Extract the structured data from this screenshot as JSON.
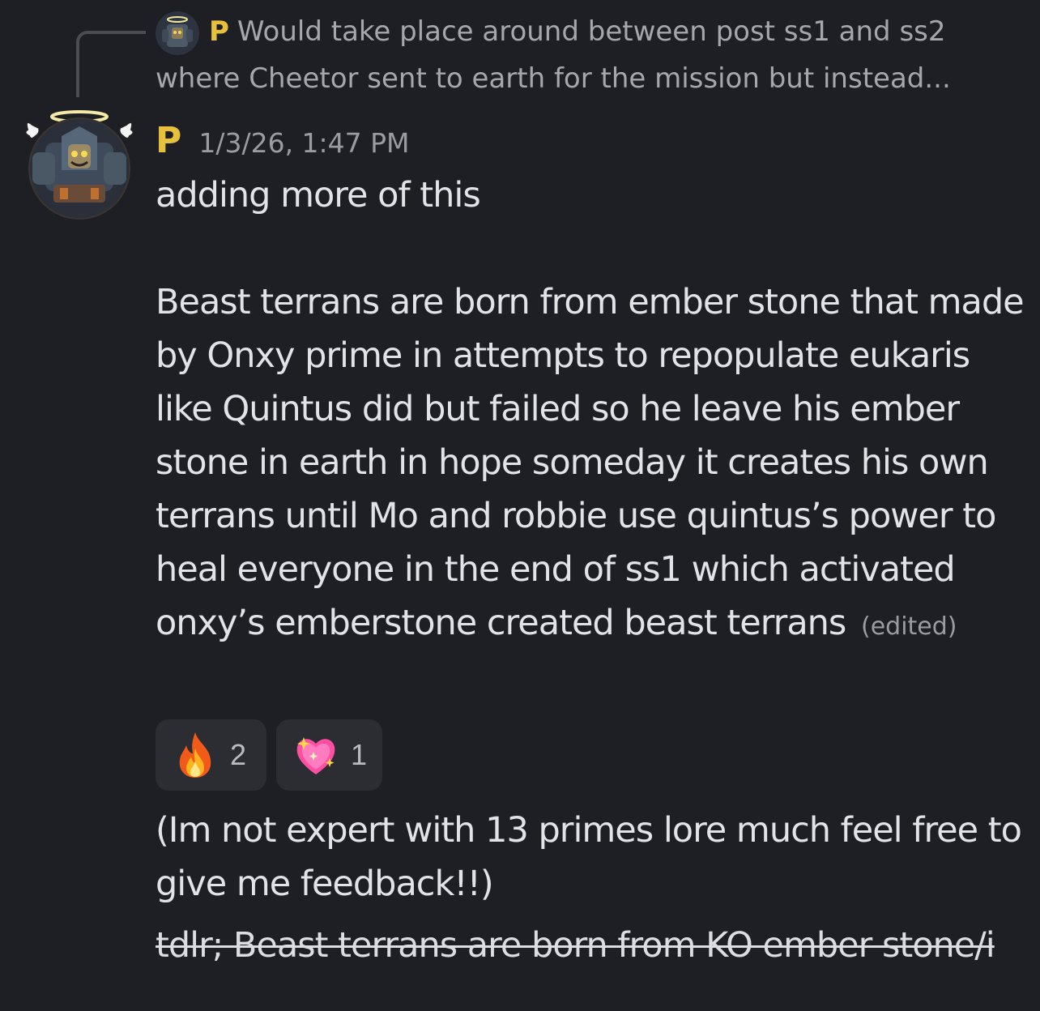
{
  "reply": {
    "author": "P",
    "preview_line1": "Would take place around between post ss1 and ss2",
    "preview_line2": "where Cheetor sent to earth for the mission but instead..."
  },
  "message": {
    "author": "P",
    "timestamp": "1/3/26, 1:47 PM",
    "line1": "adding more of this",
    "body": "Beast terrans are born from ember stone that made by Onxy prime in attempts to repopulate eukaris like Quintus did but failed so he leave his ember stone in earth in hope someday it creates his own terrans until Mo and robbie use quintus’s power to heal everyone in the end of ss1 which activated onxy’s emberstone created beast terrans",
    "edited_label": "(edited)"
  },
  "reactions": [
    {
      "emoji": "fire-emoji",
      "count": "2"
    },
    {
      "emoji": "sparkling-heart-emoji",
      "count": "1"
    }
  ],
  "followup": {
    "text": "(Im not expert with 13 primes lore much feel free to give me feedback!!)",
    "strikethrough": "tdlr; Beast terrans are born from KO ember stone/i"
  },
  "colors": {
    "background": "#1e1f24",
    "author": "#e7c03c",
    "reaction_bg": "#2c2d33"
  }
}
